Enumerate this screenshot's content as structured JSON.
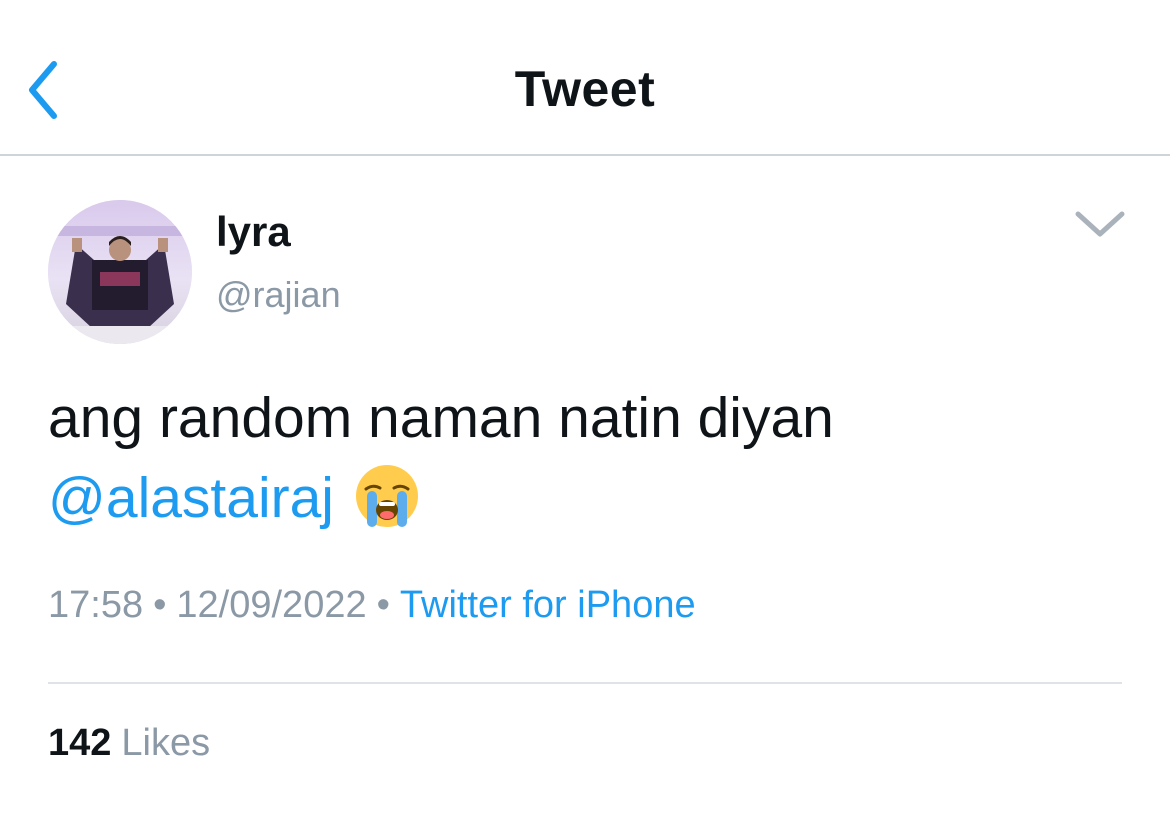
{
  "header": {
    "title": "Tweet",
    "back_icon": "chevron-left-icon"
  },
  "tweet": {
    "author": {
      "display_name": "lyra",
      "handle": "@rajian"
    },
    "text": "ang random naman natin diyan",
    "mention": "@alastairaj",
    "emoji": "😭",
    "time": "17:58",
    "date": "12/09/2022",
    "source": "Twitter for iPhone",
    "separator": "•",
    "likes_count": "142",
    "likes_label": "Likes",
    "menu_icon": "chevron-down-icon"
  },
  "colors": {
    "accent": "#1d9bf0",
    "secondary_text": "#8b98a5",
    "primary_text": "#0f1419",
    "divider": "#dfe3e7"
  }
}
